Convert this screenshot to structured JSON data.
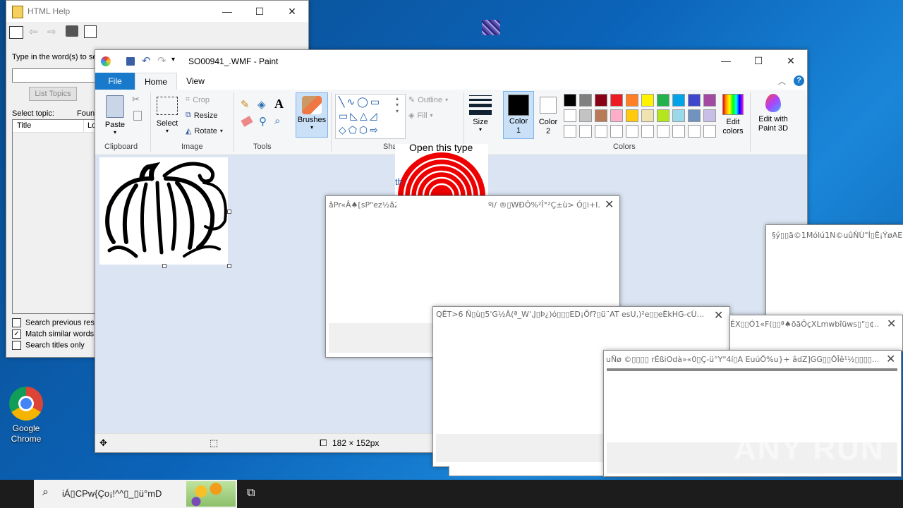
{
  "desktop": {
    "chrome_label": "Google Chrome"
  },
  "help": {
    "title": "HTML Help",
    "prompt": "Type in the word(s) to sea",
    "list_topics": "List Topics",
    "select_topic": "Select topic:",
    "found": "Foun",
    "col_title": "Title",
    "col_loc": "Lo",
    "opt1": "Search previous resu",
    "opt2": "Match similar words",
    "opt3": "Search titles only"
  },
  "paint": {
    "title": "SO00941_.WMF - Paint",
    "tabs": [
      "File",
      "Home",
      "View"
    ],
    "clipboard": {
      "paste": "Paste",
      "label": "Clipboard"
    },
    "image": {
      "select": "Select",
      "crop": "Crop",
      "resize": "Resize",
      "rotate": "Rotate",
      "label": "Image"
    },
    "tools_label": "Tools",
    "brushes": "Brushes",
    "shapes": {
      "outline": "Outline",
      "fill": "Fill",
      "label": "Shapes"
    },
    "size": "Size",
    "color1": "Color 1",
    "color2": "Color 2",
    "colors_label": "Colors",
    "edit_colors": "Edit colors",
    "edit_3d": "Edit with Paint 3D",
    "status_size": "182 × 152px",
    "palette_row1": [
      "#000000",
      "#7f7f7f",
      "#880015",
      "#ed1c24",
      "#ff7f27",
      "#fff200",
      "#22b14c",
      "#00a2e8",
      "#3f48cc",
      "#a349a4"
    ],
    "palette_row2": [
      "#ffffff",
      "#c3c3c3",
      "#b97a57",
      "#ffaec9",
      "#ffc90e",
      "#efe4b0",
      "#b5e61d",
      "#99d9ea",
      "#7092be",
      "#c8bfe7"
    ]
  },
  "target_popup": {
    "text": "Open this type",
    "partial": "th"
  },
  "dialogs": {
    "d1": "âPr«Â♠[sP\"ez½âZ",
    "d1b": "ºi/ ®▯WÐÔ%²Î°²Ç±ù> Ó▯i+I...",
    "d2": "§ý▯▯ä©1Mólú1N©uûÑÙ\"Í▯Ê¡ÝøAE",
    "d3": "QÊT>6  Ñ▯ù▯5'G½Ã(ª_W',J▯Þ¿)ó▯▯▯ED¡Õf?▯ü¨AT esU,)²e▯▯eÈkHG-cÙ...",
    "d4": "ÉX▯▯Ó1«F(▯▯ª♠õãÖçXLmwbîüws▯\"▯¢...",
    "d5": "uÑø ©▯▯▯▯ rÉßiOdà»«0▯Ç-ü°Y\"4í▯A EuúÖ%u}+ âdZ]GG▯▯ÔÎê¹½▯▯▯▯..."
  },
  "taskbar": {
    "search_text": "iÁ▯CPw{Ço¡!^^▯_▯ü°mD"
  },
  "watermark": "ANY RUN"
}
